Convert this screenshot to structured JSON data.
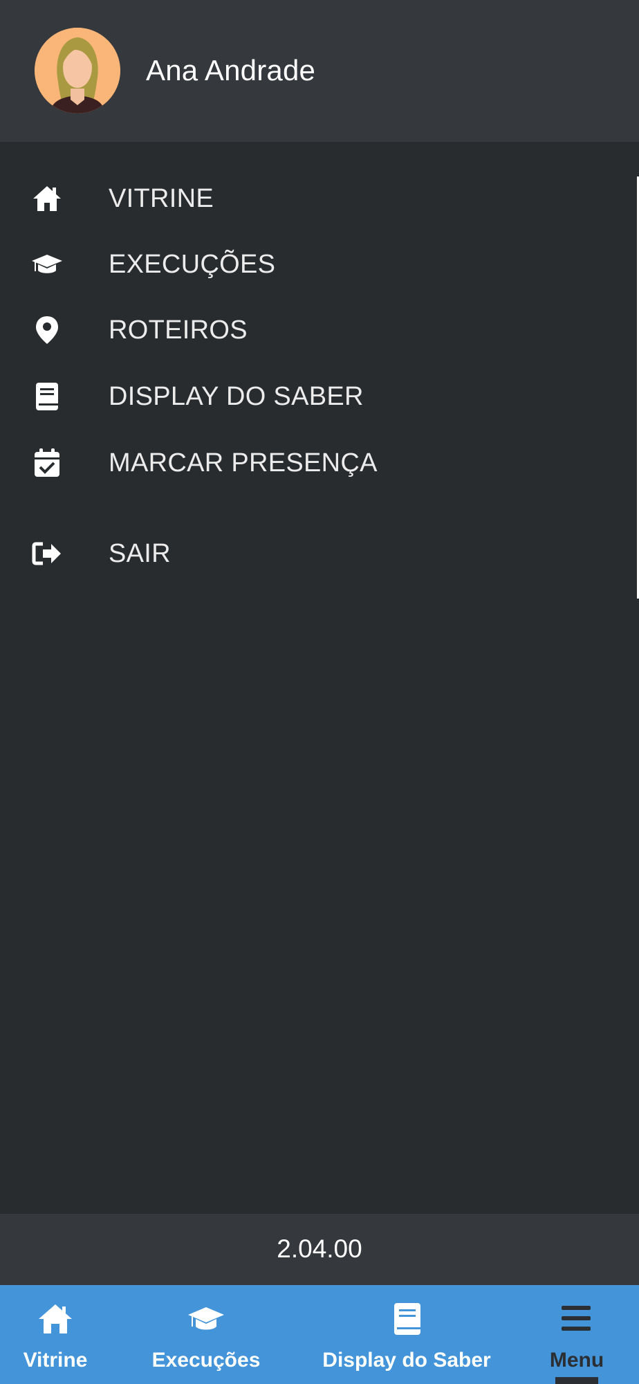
{
  "user": {
    "name": "Ana Andrade",
    "avatar_icon": "woman-avatar"
  },
  "menu": {
    "items": [
      {
        "label": "VITRINE",
        "icon": "home-icon"
      },
      {
        "label": "EXECUÇÕES",
        "icon": "graduation-cap-icon"
      },
      {
        "label": "ROTEIROS",
        "icon": "map-marker-icon"
      },
      {
        "label": "DISPLAY DO SABER",
        "icon": "book-icon"
      },
      {
        "label": "MARCAR PRESENÇA",
        "icon": "calendar-check-icon"
      }
    ],
    "logout": {
      "label": "SAIR",
      "icon": "sign-out-icon"
    }
  },
  "version": "2.04.00",
  "bottom_nav": {
    "items": [
      {
        "label": "Vitrine",
        "icon": "home-icon"
      },
      {
        "label": "Execuções",
        "icon": "graduation-cap-icon"
      },
      {
        "label": "Display do Saber",
        "icon": "book-icon"
      },
      {
        "label": "Menu",
        "icon": "hamburger-menu-icon",
        "active": true
      }
    ]
  },
  "colors": {
    "drawer_bg": "#292c2f",
    "header_bg": "#35383c",
    "bottom_nav_bg": "#4394d9",
    "active_text": "#2b2f33",
    "avatar_bg": "#f9b678"
  }
}
